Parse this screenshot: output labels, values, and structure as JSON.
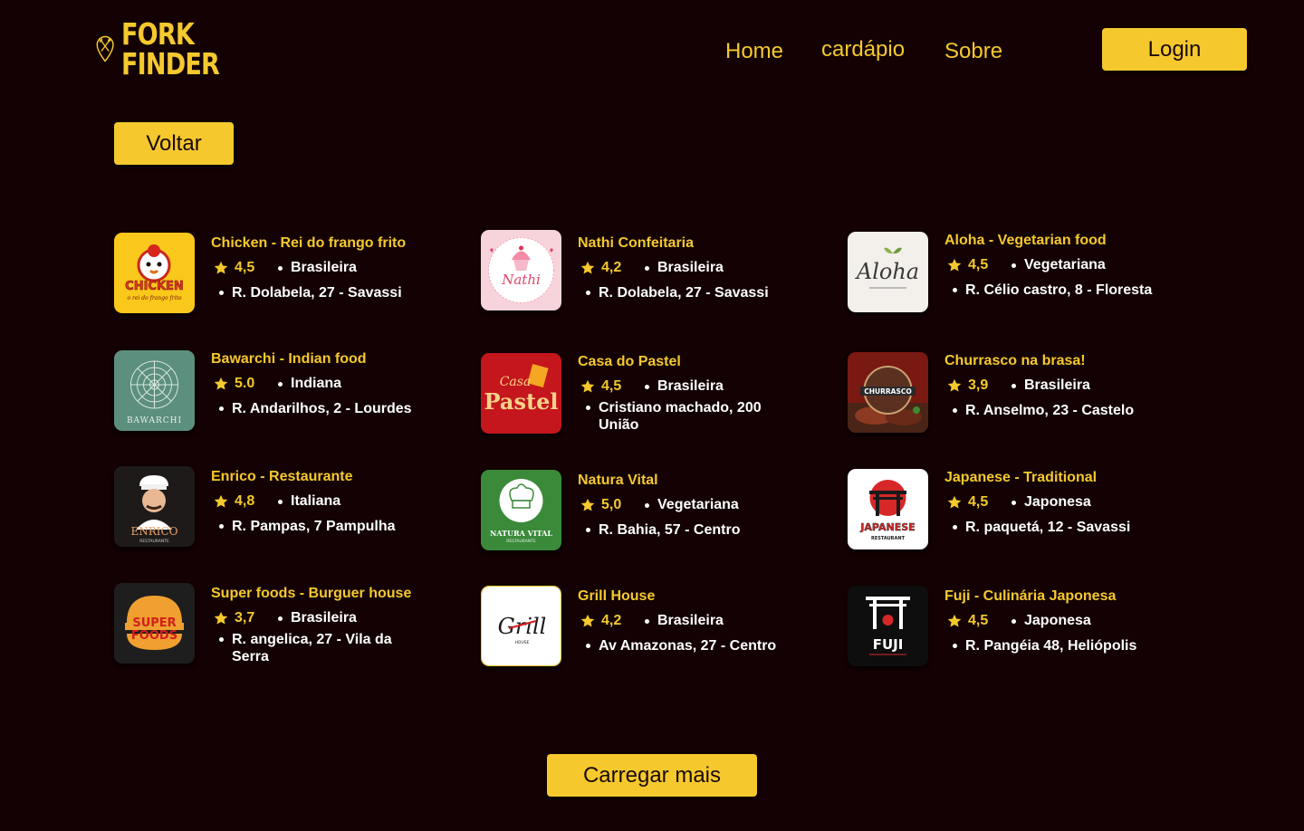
{
  "brand": {
    "line1": "FORK",
    "line2": "FINDER"
  },
  "nav": {
    "home": "Home",
    "cardapio": "cardápio",
    "sobre": "Sobre"
  },
  "buttons": {
    "login": "Login",
    "voltar": "Voltar",
    "load_more": "Carregar mais"
  },
  "colors": {
    "background": "#130103",
    "accent": "#F5C92E",
    "text_light": "#FFFFFF"
  },
  "restaurants": [
    {
      "name": "Chicken - Rei do frango frito",
      "rating": "4,5",
      "cuisine": "Brasileira",
      "address": "R. Dolabela, 27 - Savassi",
      "logo_text": "CHICKEN",
      "logo_subtext": "o rei do frango frito"
    },
    {
      "name": "Nathi Confeitaria",
      "rating": "4,2",
      "cuisine": "Brasileira",
      "address": "R. Dolabela, 27 - Savassi",
      "logo_text": "Nathi",
      "logo_subtext": ""
    },
    {
      "name": "Aloha - Vegetarian food",
      "rating": "4,5",
      "cuisine": "Vegetariana",
      "address": "R. Célio castro, 8 - Floresta",
      "logo_text": "Aloha",
      "logo_subtext": ""
    },
    {
      "name": "Bawarchi - Indian food",
      "rating": "5.0",
      "cuisine": "Indiana",
      "address": "R. Andarilhos, 2 - Lourdes",
      "logo_text": "BAWARCHI",
      "logo_subtext": ""
    },
    {
      "name": "Casa do Pastel",
      "rating": "4,5",
      "cuisine": "Brasileira",
      "address": "Cristiano machado, 200 União",
      "logo_text": "Pastel",
      "logo_subtext": "Casa"
    },
    {
      "name": "Churrasco na brasa!",
      "rating": "3,9",
      "cuisine": "Brasileira",
      "address": "R. Anselmo, 23 - Castelo",
      "logo_text": "CHURRASCO",
      "logo_subtext": ""
    },
    {
      "name": "Enrico - Restaurante",
      "rating": "4,8",
      "cuisine": "Italiana",
      "address": "R. Pampas, 7 Pampulha",
      "logo_text": "ENRICO",
      "logo_subtext": "RESTAURANTE"
    },
    {
      "name": "Natura Vital",
      "rating": "5,0",
      "cuisine": "Vegetariana",
      "address": "R. Bahia, 57 - Centro",
      "logo_text": "NATURA VITAL",
      "logo_subtext": "RESTAURANTE"
    },
    {
      "name": "Japanese - Traditional",
      "rating": "4,5",
      "cuisine": "Japonesa",
      "address": "R. paquetá, 12 - Savassi",
      "logo_text": "JAPANESE",
      "logo_subtext": "RESTAURANT"
    },
    {
      "name": "Super foods - Burguer house",
      "rating": "3,7",
      "cuisine": "Brasileira",
      "address": "R. angelica, 27 - Vila da Serra",
      "logo_text": "SUPER",
      "logo_subtext": "FOODS"
    },
    {
      "name": "Grill House",
      "rating": "4,2",
      "cuisine": "Brasileira",
      "address": "Av Amazonas, 27 - Centro",
      "logo_text": "Grill",
      "logo_subtext": "HOUSE"
    },
    {
      "name": "Fuji - Culinária Japonesa",
      "rating": "4,5",
      "cuisine": "Japonesa",
      "address": "R. Pangéia 48, Heliópolis",
      "logo_text": "FUJI",
      "logo_subtext": ""
    }
  ]
}
